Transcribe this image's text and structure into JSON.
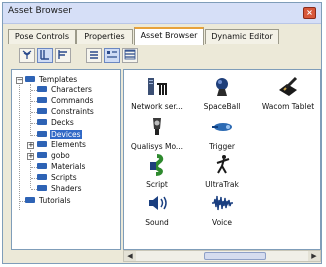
{
  "window": {
    "title": "Asset Browser",
    "close_glyph": "×"
  },
  "tabs": [
    {
      "label": "Pose Controls"
    },
    {
      "label": "Properties"
    },
    {
      "label": "Asset Browser"
    },
    {
      "label": "Dynamic Editor"
    }
  ],
  "active_tab": "Asset Browser",
  "toolbar": {
    "icons": [
      "tree-view-icon",
      "list-view-icon",
      "detail-view-icon",
      "small-icons-icon",
      "large-icons-icon",
      "thumbnails-icon"
    ]
  },
  "tree": {
    "items": [
      {
        "label": "Templates",
        "expander": "−"
      },
      {
        "label": "Characters"
      },
      {
        "label": "Commands"
      },
      {
        "label": "Constraints"
      },
      {
        "label": "Decks"
      },
      {
        "label": "Devices"
      },
      {
        "label": "Elements",
        "expander": "+"
      },
      {
        "label": "gobo",
        "expander": "+"
      },
      {
        "label": "Materials"
      },
      {
        "label": "Scripts"
      },
      {
        "label": "Shaders"
      },
      {
        "label": "Tutorials"
      }
    ],
    "selected": "Devices"
  },
  "devices": [
    {
      "label": "Network ser...",
      "icon": "network-server-icon"
    },
    {
      "label": "SpaceBall",
      "icon": "spaceball-icon"
    },
    {
      "label": "Wacom Tablet",
      "icon": "wacom-tablet-icon"
    },
    {
      "label": "Qualisys Mo...",
      "icon": "qualisys-motion-icon"
    },
    {
      "label": "Trigger",
      "icon": "trigger-icon"
    },
    {
      "label": "Script",
      "icon": "script-icon"
    },
    {
      "label": "UltraTrak",
      "icon": "ultratrak-icon"
    },
    {
      "label": "Sound",
      "icon": "sound-icon"
    },
    {
      "label": "Voice",
      "icon": "voice-icon"
    }
  ],
  "scroll_arrows": {
    "left": "◀",
    "right": "▶"
  }
}
